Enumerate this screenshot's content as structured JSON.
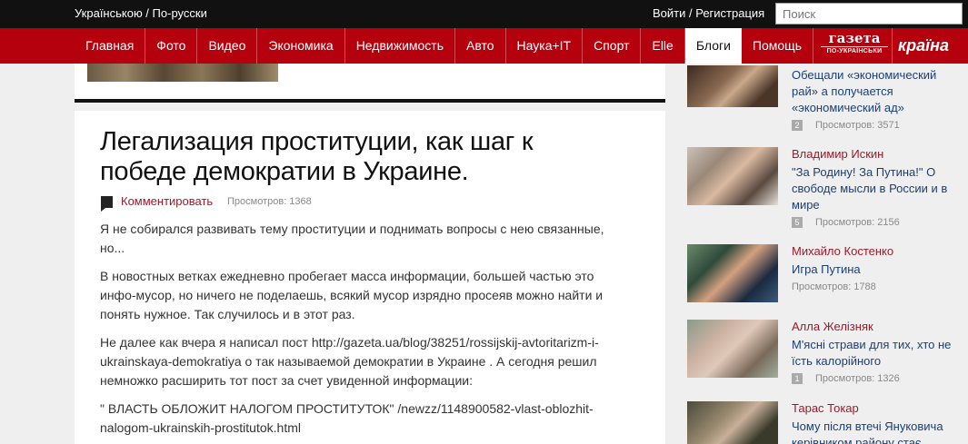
{
  "topbar": {
    "language_links": "Українською / По-русски",
    "auth_links": "Войти / Регистрация",
    "search_placeholder": "Поиск"
  },
  "nav": {
    "items": [
      "Главная",
      "Фото",
      "Видео",
      "Экономика",
      "Недвижимость",
      "Авто",
      "Наука+IT",
      "Спорт",
      "Elle",
      "Блоги",
      "Помощь"
    ],
    "active": "Блоги",
    "brand_gazeta": "газета",
    "brand_gazeta_sub": "ПО-УКРАЇНСЬКИ",
    "brand_kraina": "країна"
  },
  "post": {
    "title": "Легализация проституции, как шаг к победе демократии в Украине.",
    "comment_label": "Комментировать",
    "views": "Просмотров: 1368",
    "paragraphs": [
      "Я не собирался развивать тему проституции и поднимать вопросы с нею связанные, но...",
      "В новостных ветках ежедневно пробегает масса информации, большей частью это инфо-мусор, но ничего не поделаешь, всякий мусор изрядно просеяв можно найти и понять нужное. Так случилось и в этот раз.",
      "Не далее как вчера я написал пост  http://gazeta.ua/blog/38251/rossijskij-avtoritarizm-i-ukrainskaya-demokratiya о так называемой демократии в Украине . А сегодня решил немножко расширить тот пост за счет увиденной информации:",
      "\" ВЛАСТЬ ОБЛОЖИТ НАЛОГОМ ПРОСТИТУТОК\"  /newzz/1148900582-vlast-oblozhit-nalogom-ukrainskih-prostitutok.html"
    ]
  },
  "sidebar": {
    "items": [
      {
        "author": "",
        "title": "Обещали «экономический рай» а получается «экономический ад»",
        "comments": "2",
        "views": "Просмотров: 3571"
      },
      {
        "author": "Владимир Искин",
        "title": "\"За Родину! За Путина!\" О свободе мысли в России и в мире",
        "comments": "5",
        "views": "Просмотров: 2156"
      },
      {
        "author": "Михайло Костенко",
        "title": "Игра Путина",
        "comments": "",
        "views": "Просмотров: 1788"
      },
      {
        "author": "Алла Желізняк",
        "title": "М'ясні страви для тих, хто не їсть калорійного",
        "comments": "1",
        "views": "Просмотров: 1326"
      },
      {
        "author": "Тарас Токар",
        "title": "Чому після втечі Януковича керівником району стає",
        "comments": "",
        "views": ""
      }
    ]
  },
  "colors": {
    "topbar": "#111111",
    "navbar": "#b5000d",
    "link_red": "#a0192a",
    "link_blue": "#1c3f73"
  }
}
